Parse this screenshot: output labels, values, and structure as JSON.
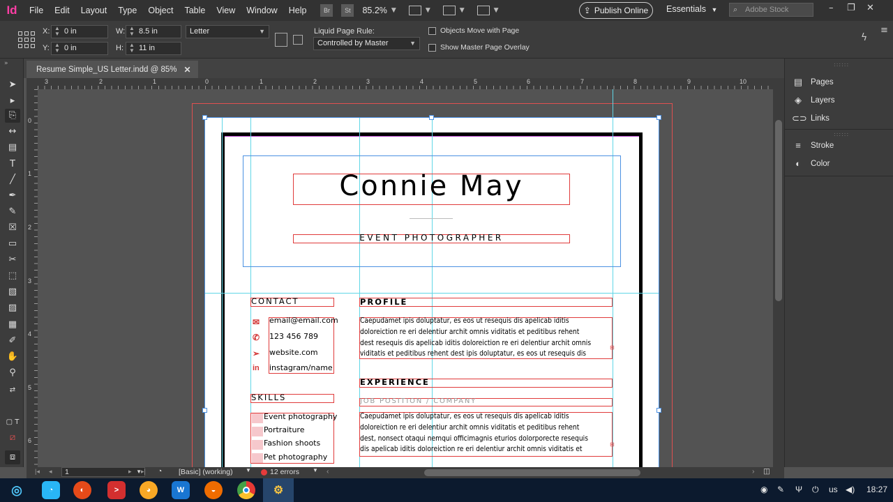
{
  "app": {
    "logo": "Id"
  },
  "menu": [
    "File",
    "Edit",
    "Layout",
    "Type",
    "Object",
    "Table",
    "View",
    "Window",
    "Help"
  ],
  "header": {
    "br": "Br",
    "st": "St",
    "zoom": "85.2%",
    "publish": "Publish Online",
    "workspace": "Essentials",
    "stock_placeholder": "Adobe Stock"
  },
  "control": {
    "x_label": "X:",
    "x_value": "0 in",
    "y_label": "Y:",
    "y_value": "0 in",
    "w_label": "W:",
    "w_value": "8.5 in",
    "h_label": "H:",
    "h_value": "11 in",
    "page_size": "Letter",
    "liquid_label": "Liquid Page Rule:",
    "liquid_value": "Controlled by Master",
    "objects_move": "Objects Move with Page",
    "show_master": "Show Master Page Overlay"
  },
  "document": {
    "tab_title": "Resume Simple_US Letter.indd @ 85%"
  },
  "rulers": {
    "h": [
      "3",
      "2",
      "1",
      "0",
      "1",
      "2",
      "3",
      "4",
      "5",
      "6",
      "7",
      "8",
      "9",
      "10"
    ],
    "v": [
      "0",
      "1",
      "2",
      "3",
      "4",
      "5",
      "6"
    ]
  },
  "panels": [
    "Pages",
    "Layers",
    "Links",
    "Stroke",
    "Color"
  ],
  "status": {
    "page": "1",
    "style": "[Basic] (working)",
    "errors": "12 errors"
  },
  "resume": {
    "name": "Connie May",
    "title": "EVENT PHOTOGRAPHER",
    "contact_heading": "CONTACT",
    "contact": [
      "email@email.com",
      "123 456 789",
      "website.com",
      "instagram/name"
    ],
    "skills_heading": "SKILLS",
    "skills": [
      "Event photography",
      "Portraiture",
      "Fashion shoots",
      "Pet photography"
    ],
    "profile_heading": "PROFILE",
    "profile_lines": [
      "Caepudamet ipis doluptatur, es eos ut resequis dis apelicab iditis",
      "doloreiction re eri delentiur archit omnis viditatis et peditibus rehent",
      "dest resequis dis apelicab iditis doloreiction re eri delentiur archit omnis",
      "viditatis et peditibus rehent dest  ipis doluptatur, es eos ut resequis dis"
    ],
    "experience_heading": "EXPERIENCE",
    "job_position": "JOB POSITION / COMPANY",
    "experience_lines": [
      "Caepudamet ipis doluptatur, es eos ut resequis dis apelicab iditis",
      "doloreiction re eri delentiur archit omnis viditatis et peditibus rehent",
      "dest, nonsect otaqui nemqui officimagnis eturios dolorporecte resequis",
      "dis apelicab iditis doloreiction re eri delentiur archit omnis viditatis et"
    ]
  },
  "taskbar": {
    "lang": "us",
    "time": "18:27"
  },
  "colors": {
    "accent_red": "#e03a3a",
    "guide_cyan": "#5fd6e6",
    "frame_blue": "#4a90e2",
    "skill_pink": "#f6c8cc"
  }
}
